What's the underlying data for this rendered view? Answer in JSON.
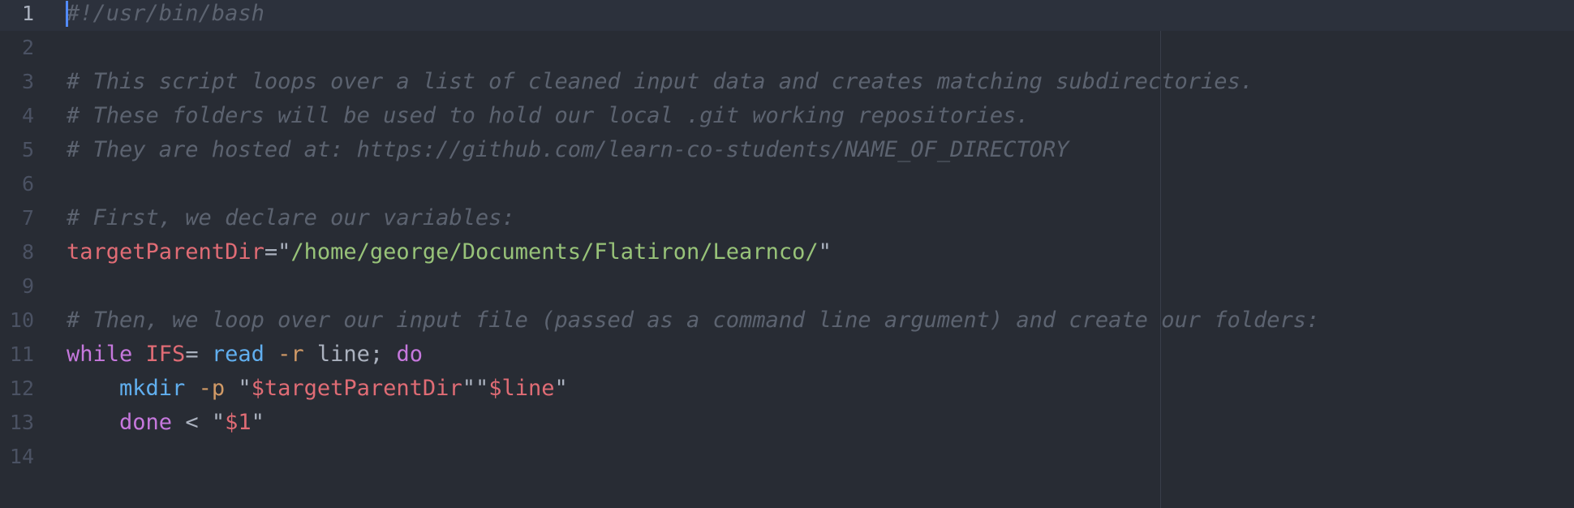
{
  "editor": {
    "language": "bash",
    "cursor": {
      "line": 1,
      "column": 1
    },
    "colors": {
      "background": "#282c34",
      "comment": "#5c6370",
      "variable": "#e06c75",
      "string": "#98c379",
      "keyword": "#c678dd",
      "function": "#61afef",
      "option": "#d19a66",
      "plain": "#abb2bf",
      "cursor": "#528bff"
    },
    "lines": [
      {
        "number": "1",
        "tokens": [
          {
            "type": "comment",
            "text": "#!/usr/bin/bash"
          }
        ]
      },
      {
        "number": "2",
        "tokens": []
      },
      {
        "number": "3",
        "tokens": [
          {
            "type": "comment",
            "text": "# This script loops over a list of cleaned input data and creates matching subdirectories."
          }
        ]
      },
      {
        "number": "4",
        "tokens": [
          {
            "type": "comment",
            "text": "# These folders will be used to hold our local .git working repositories."
          }
        ]
      },
      {
        "number": "5",
        "tokens": [
          {
            "type": "comment",
            "text": "# They are hosted at: https://github.com/learn-co-students/NAME_OF_DIRECTORY"
          }
        ]
      },
      {
        "number": "6",
        "tokens": []
      },
      {
        "number": "7",
        "tokens": [
          {
            "type": "comment",
            "text": "# First, we declare our variables:"
          }
        ]
      },
      {
        "number": "8",
        "tokens": [
          {
            "type": "var",
            "text": "targetParentDir"
          },
          {
            "type": "plain",
            "text": "="
          },
          {
            "type": "plain",
            "text": "\""
          },
          {
            "type": "str",
            "text": "/home/george/Documents/Flatiron/Learnco/"
          },
          {
            "type": "plain",
            "text": "\""
          }
        ]
      },
      {
        "number": "9",
        "tokens": []
      },
      {
        "number": "10",
        "tokens": [
          {
            "type": "comment",
            "text": "# Then, we loop over our input file (passed as a command line argument) and create our folders:"
          }
        ]
      },
      {
        "number": "11",
        "tokens": [
          {
            "type": "kw",
            "text": "while"
          },
          {
            "type": "plain",
            "text": " "
          },
          {
            "type": "var",
            "text": "IFS"
          },
          {
            "type": "plain",
            "text": "= "
          },
          {
            "type": "fn",
            "text": "read"
          },
          {
            "type": "plain",
            "text": " "
          },
          {
            "type": "opt",
            "text": "-r"
          },
          {
            "type": "plain",
            "text": " line; "
          },
          {
            "type": "kw",
            "text": "do"
          }
        ]
      },
      {
        "number": "12",
        "tokens": [
          {
            "type": "plain",
            "text": "    "
          },
          {
            "type": "fn",
            "text": "mkdir"
          },
          {
            "type": "plain",
            "text": " "
          },
          {
            "type": "opt",
            "text": "-p"
          },
          {
            "type": "plain",
            "text": " \""
          },
          {
            "type": "var",
            "text": "$targetParentDir"
          },
          {
            "type": "plain",
            "text": "\"\""
          },
          {
            "type": "var",
            "text": "$line"
          },
          {
            "type": "plain",
            "text": "\""
          }
        ]
      },
      {
        "number": "13",
        "tokens": [
          {
            "type": "plain",
            "text": "    "
          },
          {
            "type": "kw",
            "text": "done"
          },
          {
            "type": "plain",
            "text": " < \""
          },
          {
            "type": "var",
            "text": "$1"
          },
          {
            "type": "plain",
            "text": "\""
          }
        ]
      },
      {
        "number": "14",
        "tokens": []
      }
    ]
  }
}
